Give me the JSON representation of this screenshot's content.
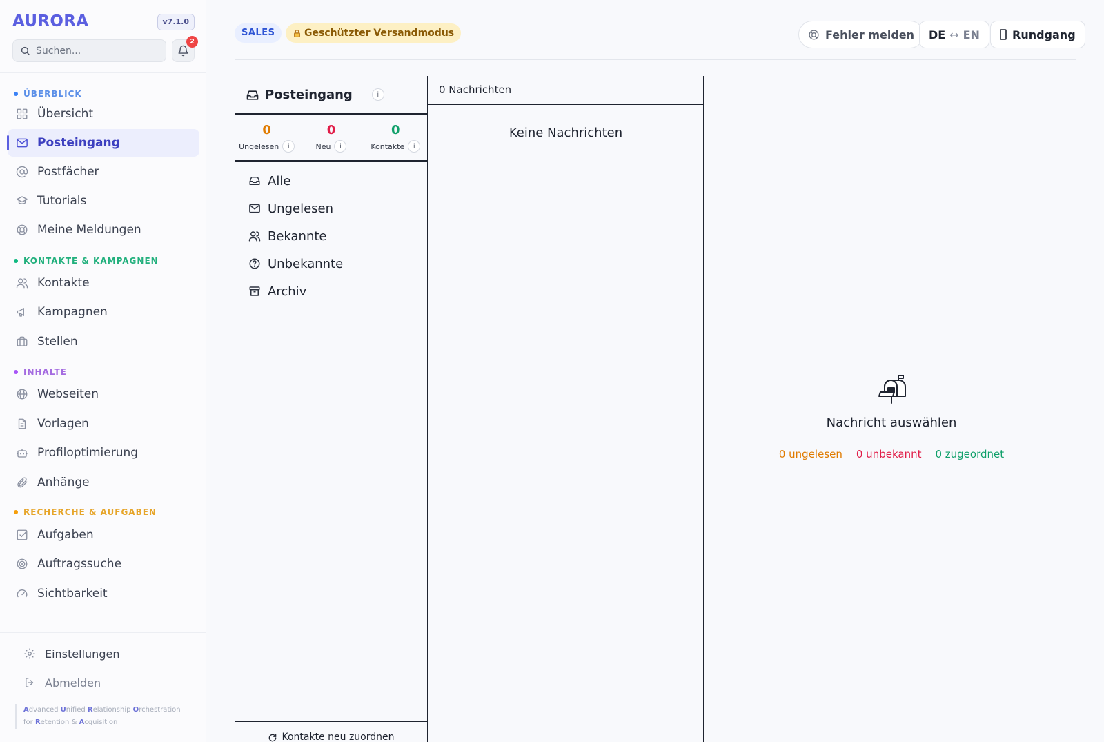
{
  "sidebar": {
    "brand": "AURORA",
    "version": "v7.1.0",
    "search_placeholder": "Suchen...",
    "notification_count": "2",
    "sections": [
      {
        "label": "ÜBERBLICK",
        "color": "#3b82f6",
        "items": [
          {
            "label": "Übersicht",
            "icon": "grid-icon"
          },
          {
            "label": "Posteingang",
            "icon": "mail-icon",
            "active": true
          },
          {
            "label": "Postfächer",
            "icon": "at-icon"
          },
          {
            "label": "Tutorials",
            "icon": "graduation-cap-icon"
          },
          {
            "label": "Meine Meldungen",
            "icon": "lifebuoy-icon"
          }
        ]
      },
      {
        "label": "KONTAKTE & KAMPAGNEN",
        "color": "#10b981",
        "items": [
          {
            "label": "Kontakte",
            "icon": "users-icon"
          },
          {
            "label": "Kampagnen",
            "icon": "megaphone-icon"
          },
          {
            "label": "Stellen",
            "icon": "briefcase-icon"
          }
        ]
      },
      {
        "label": "INHALTE",
        "color": "#a855f7",
        "items": [
          {
            "label": "Webseiten",
            "icon": "globe-icon"
          },
          {
            "label": "Vorlagen",
            "icon": "file-text-icon"
          },
          {
            "label": "Profiloptimierung",
            "icon": "bot-icon"
          },
          {
            "label": "Anhänge",
            "icon": "paperclip-icon"
          }
        ]
      },
      {
        "label": "RECHERCHE & AUFGABEN",
        "color": "#f59e0b",
        "items": [
          {
            "label": "Aufgaben",
            "icon": "check-square-icon"
          },
          {
            "label": "Auftragssuche",
            "icon": "target-icon"
          },
          {
            "label": "Sichtbarkeit",
            "icon": "gauge-icon"
          }
        ]
      }
    ],
    "bottom": {
      "settings": "Einstellungen",
      "logout": "Abmelden"
    },
    "acronym": [
      {
        "initial": "A",
        "rest": "dvanced "
      },
      {
        "initial": "U",
        "rest": "nified "
      },
      {
        "initial": "R",
        "rest": "elationship "
      },
      {
        "initial": "O",
        "rest": "rchestration for "
      },
      {
        "initial": "R",
        "rest": "etention & "
      },
      {
        "initial": "A",
        "rest": "cquisition"
      }
    ]
  },
  "topbar": {
    "workspace": "SALES",
    "mode": "Geschützter Versandmodus",
    "report_bug": "Fehler melden",
    "lang_de": "DE",
    "lang_arrow": "↔",
    "lang_en": "EN",
    "tour": "Rundgang"
  },
  "inbox": {
    "title": "Posteingang",
    "info": "i",
    "stats": [
      {
        "value": "0",
        "label": "Ungelesen",
        "color": "#e07b00"
      },
      {
        "value": "0",
        "label": "Neu",
        "color": "#e11d48"
      },
      {
        "value": "0",
        "label": "Kontakte",
        "color": "#10a06a"
      }
    ],
    "folders": [
      {
        "label": "Alle",
        "icon": "inbox-icon"
      },
      {
        "label": "Ungelesen",
        "icon": "mail-icon"
      },
      {
        "label": "Bekannte",
        "icon": "users-icon"
      },
      {
        "label": "Unbekannte",
        "icon": "help-circle-icon"
      },
      {
        "label": "Archiv",
        "icon": "archive-icon"
      }
    ],
    "footer": "Kontakte neu zuordnen"
  },
  "messages": {
    "count_label": "0 Nachrichten",
    "empty": "Keine Nachrichten"
  },
  "detail": {
    "title": "Nachricht auswählen",
    "unread": "0 ungelesen",
    "unknown": "0 unbekannt",
    "assigned": "0 zugeordnet"
  },
  "colors": {
    "accent": "#5b5fe0",
    "unread": "#e07b00",
    "unknown": "#e11d48",
    "assigned": "#10a06a"
  }
}
